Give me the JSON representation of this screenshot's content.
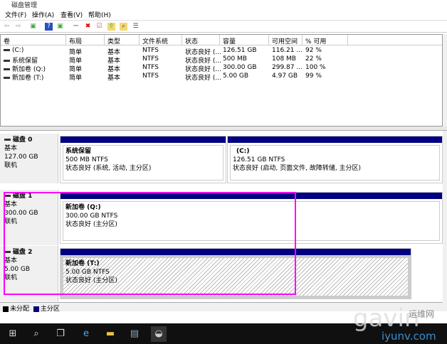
{
  "window": {
    "title": "磁盘管理"
  },
  "menu": [
    "文件(F)",
    "操作(A)",
    "查看(V)",
    "帮助(H)"
  ],
  "toolbar": [
    {
      "icon": "back-arrow-icon",
      "glyph": "⇦"
    },
    {
      "icon": "forward-arrow-icon",
      "glyph": "⇨"
    },
    {
      "icon": "console-tree-icon",
      "glyph": "▣"
    },
    {
      "icon": "help-icon",
      "glyph": "?"
    },
    {
      "icon": "show-panel-icon",
      "glyph": "▣"
    },
    {
      "icon": "connect-drive-icon",
      "glyph": "⎓"
    },
    {
      "icon": "delete-icon",
      "glyph": "✖"
    },
    {
      "icon": "check-icon",
      "glyph": "☑"
    },
    {
      "icon": "folder-up-icon",
      "glyph": "⇧"
    },
    {
      "icon": "search-folder-icon",
      "glyph": "⌕"
    },
    {
      "icon": "properties-icon",
      "glyph": "☰"
    }
  ],
  "table": {
    "columns": [
      "卷",
      "布局",
      "类型",
      "文件系统",
      "状态",
      "容量",
      "可用空间",
      "% 可用"
    ],
    "rows": [
      [
        "(C:)",
        "简单",
        "基本",
        "NTFS",
        "状态良好 (...",
        "126.51 GB",
        "116.21 ...",
        "92 %"
      ],
      [
        "系统保留",
        "简单",
        "基本",
        "NTFS",
        "状态良好 (...",
        "500 MB",
        "108 MB",
        "22 %"
      ],
      [
        "新加卷 (Q:)",
        "简单",
        "基本",
        "NTFS",
        "状态良好 (...",
        "300.00 GB",
        "299.87 ...",
        "100 %"
      ],
      [
        "新加卷 (T:)",
        "简单",
        "基本",
        "NTFS",
        "状态良好 (...",
        "5.00 GB",
        "4.97 GB",
        "99 %"
      ]
    ]
  },
  "disks": [
    {
      "name": "磁盘 0",
      "type": "基本",
      "size": "127.00 GB",
      "status": "联机",
      "partitions": [
        {
          "name": "系统保留",
          "size": "500 MB NTFS",
          "status": "状态良好 (系统, 活动, 主分区)"
        },
        {
          "name": "(C:)",
          "size": "126.51 GB NTFS",
          "status": "状态良好 (启动, 页面文件, 故障转储, 主分区)"
        }
      ]
    },
    {
      "name": "磁盘 1",
      "type": "基本",
      "size": "300.00 GB",
      "status": "联机",
      "partitions": [
        {
          "name": "新加卷  (Q:)",
          "size": "300.00 GB NTFS",
          "status": "状态良好 (主分区)"
        }
      ]
    },
    {
      "name": "磁盘 2",
      "type": "基本",
      "size": "5.00 GB",
      "status": "联机",
      "partitions": [
        {
          "name": "新加卷  (T:)",
          "size": "5.00 GB NTFS",
          "status": "状态良好 (主分区)"
        }
      ]
    }
  ],
  "legend": [
    {
      "label": "未分配",
      "color": "#000000"
    },
    {
      "label": "主分区",
      "color": "#000080"
    }
  ],
  "colors": {
    "partition_bar": "#000080",
    "highlight": "#ff00ff"
  },
  "watermark": {
    "text1": "gavin",
    "text2": "运维网",
    "text3": "iyunv.com"
  }
}
